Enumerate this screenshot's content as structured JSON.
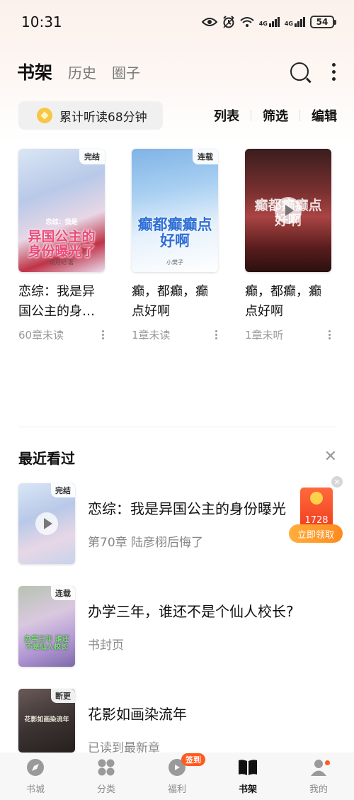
{
  "status_bar": {
    "time": "10:31",
    "battery": "54",
    "icons": [
      "eye-icon",
      "alarm-icon",
      "wifi-icon",
      "signal-4g-icon",
      "signal-4g-icon",
      "battery-icon"
    ],
    "network_labels": [
      "4G",
      "4G"
    ]
  },
  "header": {
    "tabs": [
      {
        "label": "书架",
        "active": true
      },
      {
        "label": "历史",
        "active": false
      },
      {
        "label": "圈子",
        "active": false
      }
    ]
  },
  "toolbar": {
    "listen_text": "累计听读68分钟",
    "actions": [
      "列表",
      "筛选",
      "编辑"
    ]
  },
  "shelf": {
    "books": [
      {
        "title": "恋综：我是异国公主的身…",
        "meta": "60章未读",
        "tag": "完结",
        "cover_title": "异国公主的身份曝光了",
        "cover_subtitle": "恋综：我是",
        "cover_author": "琼月纪·著"
      },
      {
        "title": "癫，都癫，癫点好啊",
        "meta": "1章未读",
        "tag": "连载",
        "cover_title": "癫都癫癫点好啊",
        "cover_author": "小樊子"
      },
      {
        "title": "癫，都癫，癫点好啊",
        "meta": "1章未听",
        "cover_title": "癫都癫癫点好啊"
      }
    ]
  },
  "recent": {
    "title": "最近看过",
    "items": [
      {
        "title": "恋综：我是异国公主的身份曝光",
        "progress": "第70章 陆彦栩后悔了",
        "tag": "完结"
      },
      {
        "title": "办学三年，谁还不是个仙人校长?",
        "progress": "书封页",
        "tag": "连载",
        "cover_text": "办学三年 谁还不是仙人校长"
      },
      {
        "title": "花影如画染流年",
        "progress": "已读到最新章",
        "tag": "断更",
        "cover_text": "花影如画染流年"
      }
    ]
  },
  "reward": {
    "amount": "1728",
    "button": "立即领取"
  },
  "bottom_nav": {
    "items": [
      {
        "label": "书城",
        "icon": "compass-icon",
        "active": false
      },
      {
        "label": "分类",
        "icon": "grid-icon",
        "active": false
      },
      {
        "label": "福利",
        "icon": "gift-icon",
        "active": false,
        "badge": "签到"
      },
      {
        "label": "书架",
        "icon": "bookshelf-icon",
        "active": true
      },
      {
        "label": "我的",
        "icon": "profile-icon",
        "active": false
      }
    ]
  },
  "colors": {
    "accent": "#ff8a1f",
    "badge": "#ff5a1f"
  }
}
